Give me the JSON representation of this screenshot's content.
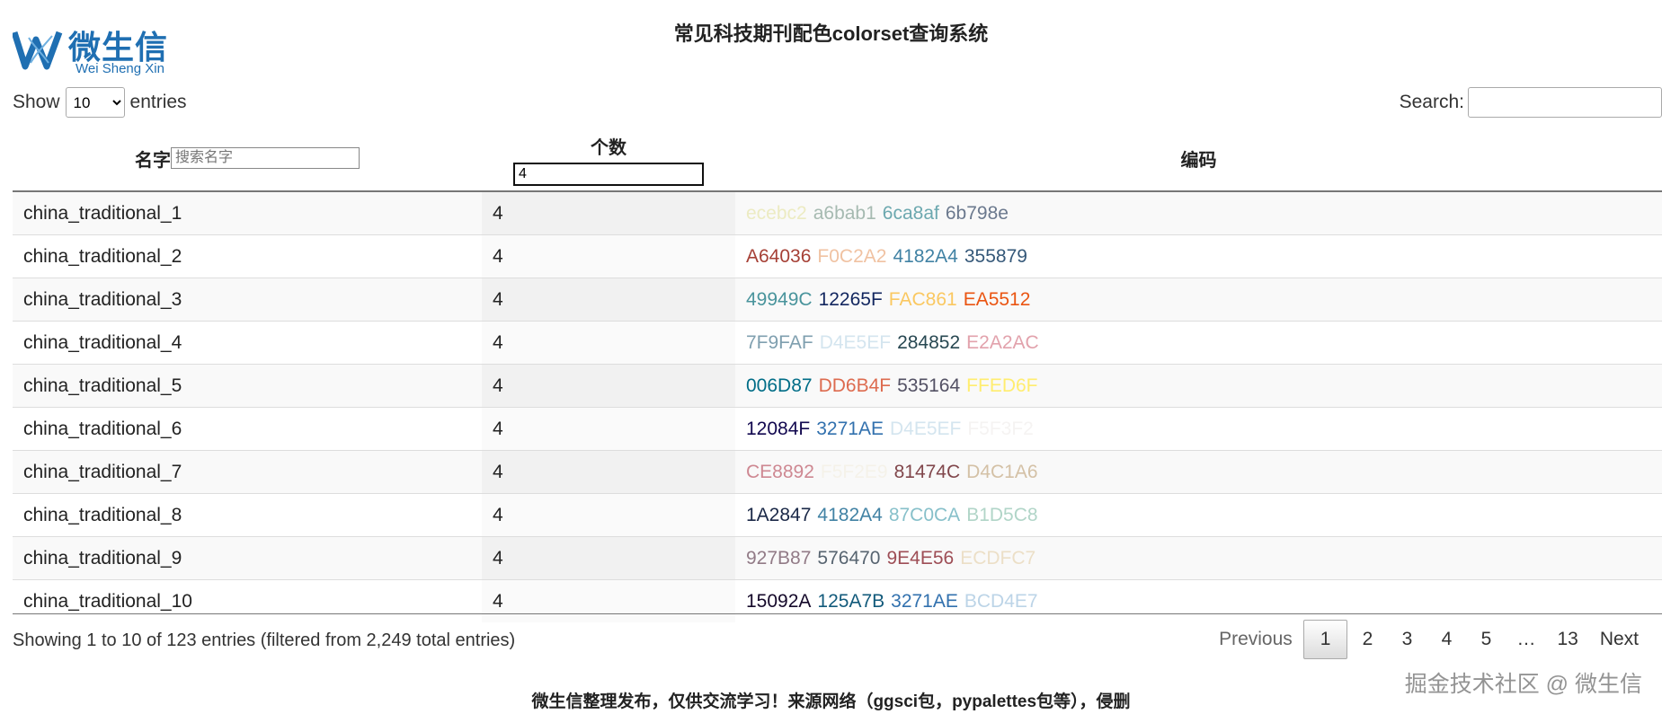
{
  "logo": {
    "cn": "微生信",
    "en": "Wei Sheng Xin"
  },
  "page_title": "常见科技期刊配色colorset查询系统",
  "length_control": {
    "prefix": "Show",
    "selected": "10",
    "suffix": "entries"
  },
  "search": {
    "label": "Search:",
    "value": ""
  },
  "columns": {
    "name": {
      "label": "名字",
      "filter_placeholder": "搜索名字"
    },
    "count": {
      "label": "个数",
      "filter_value": "4"
    },
    "code": {
      "label": "编码"
    }
  },
  "rows": [
    {
      "name": "china_traditional_1",
      "count": "4",
      "codes": [
        {
          "text": "ecebc2",
          "color": "#ecebc2"
        },
        {
          "text": "a6bab1",
          "color": "#a6bab1"
        },
        {
          "text": "6ca8af",
          "color": "#6ca8af"
        },
        {
          "text": "6b798e",
          "color": "#6b798e"
        }
      ]
    },
    {
      "name": "china_traditional_2",
      "count": "4",
      "codes": [
        {
          "text": "A64036",
          "color": "#A64036"
        },
        {
          "text": "F0C2A2",
          "color": "#F0C2A2"
        },
        {
          "text": "4182A4",
          "color": "#4182A4"
        },
        {
          "text": "355879",
          "color": "#355879"
        }
      ]
    },
    {
      "name": "china_traditional_3",
      "count": "4",
      "codes": [
        {
          "text": "49949C",
          "color": "#49949C"
        },
        {
          "text": "12265F",
          "color": "#12265F"
        },
        {
          "text": "FAC861",
          "color": "#FAC861"
        },
        {
          "text": "EA5512",
          "color": "#EA5512"
        }
      ]
    },
    {
      "name": "china_traditional_4",
      "count": "4",
      "codes": [
        {
          "text": "7F9FAF",
          "color": "#7F9FAF"
        },
        {
          "text": "D4E5EF",
          "color": "#D4E5EF"
        },
        {
          "text": "284852",
          "color": "#284852"
        },
        {
          "text": "E2A2AC",
          "color": "#E2A2AC"
        }
      ]
    },
    {
      "name": "china_traditional_5",
      "count": "4",
      "codes": [
        {
          "text": "006D87",
          "color": "#006D87"
        },
        {
          "text": "DD6B4F",
          "color": "#DD6B4F"
        },
        {
          "text": "535164",
          "color": "#535164"
        },
        {
          "text": "FFED6F",
          "color": "#FFED6F"
        }
      ]
    },
    {
      "name": "china_traditional_6",
      "count": "4",
      "codes": [
        {
          "text": "12084F",
          "color": "#12084F"
        },
        {
          "text": "3271AE",
          "color": "#3271AE"
        },
        {
          "text": "D4E5EF",
          "color": "#D4E5EF"
        },
        {
          "text": "F5F3F2",
          "color": "#F5F3F2"
        }
      ]
    },
    {
      "name": "china_traditional_7",
      "count": "4",
      "codes": [
        {
          "text": "CE8892",
          "color": "#CE8892"
        },
        {
          "text": "F5F2E9",
          "color": "#F5F2E9"
        },
        {
          "text": "81474C",
          "color": "#81474C"
        },
        {
          "text": "D4C1A6",
          "color": "#D4C1A6"
        }
      ]
    },
    {
      "name": "china_traditional_8",
      "count": "4",
      "codes": [
        {
          "text": "1A2847",
          "color": "#1A2847"
        },
        {
          "text": "4182A4",
          "color": "#4182A4"
        },
        {
          "text": "87C0CA",
          "color": "#87C0CA"
        },
        {
          "text": "B1D5C8",
          "color": "#B1D5C8"
        }
      ]
    },
    {
      "name": "china_traditional_9",
      "count": "4",
      "codes": [
        {
          "text": "927B87",
          "color": "#927B87"
        },
        {
          "text": "576470",
          "color": "#576470"
        },
        {
          "text": "9E4E56",
          "color": "#9E4E56"
        },
        {
          "text": "ECDFC7",
          "color": "#ECDFC7"
        }
      ]
    },
    {
      "name": "china_traditional_10",
      "count": "4",
      "codes": [
        {
          "text": "15092A",
          "color": "#15092A"
        },
        {
          "text": "125A7B",
          "color": "#125A7B"
        },
        {
          "text": "3271AE",
          "color": "#3271AE"
        },
        {
          "text": "BCD4E7",
          "color": "#BCD4E7"
        }
      ]
    }
  ],
  "info": "Showing 1 to 10 of 123 entries (filtered from 2,249 total entries)",
  "pagination": {
    "previous": "Previous",
    "pages": [
      "1",
      "2",
      "3",
      "4",
      "5",
      "…",
      "13"
    ],
    "current": "1",
    "next": "Next"
  },
  "footer": "微生信整理发布，仅供交流学习！来源网络（ggsci包，pypalettes包等），侵删",
  "watermark": "掘金技术社区 @ 微生信",
  "colors": {
    "logo_blue": "#1f6fb2"
  }
}
